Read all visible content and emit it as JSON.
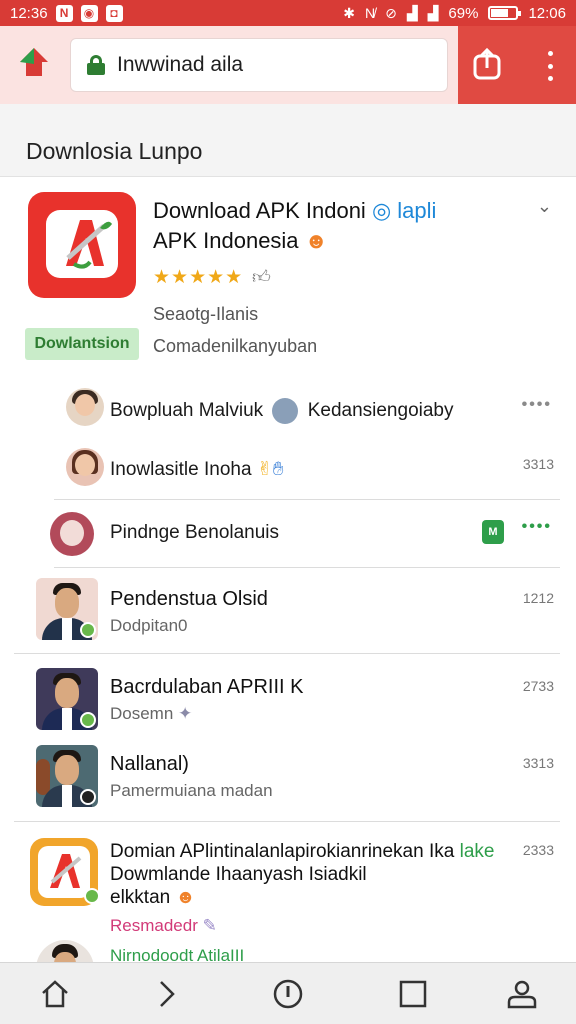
{
  "status_bar": {
    "time_left": "12:36 ",
    "time_right": "12:06",
    "battery": "69%",
    "battery_level": 0.69
  },
  "toolbar": {
    "url": "Inwwinad aila"
  },
  "page": {
    "title": "Downlosia Lunpo"
  },
  "app": {
    "title_line1": "Download APK Indoni",
    "title_blue": "lapli",
    "title_line2": "APK Indonesia",
    "rating": 5,
    "meta": "Seaotg-Ilanis",
    "badge": "Dowlantsion",
    "subtitle": "Comadenilkanyuban"
  },
  "threads": [
    {
      "text": "Bowpluah Malviuk",
      "text2": "Kedansiengoiaby",
      "end": "••••"
    },
    {
      "text": "Inowlasitle Inoha",
      "end": "3313"
    },
    {
      "text": "Pindnge Benolanuis",
      "chip": "M",
      "end": "••••"
    }
  ],
  "contacts": [
    {
      "name": "Pendenstua Olsid",
      "sub": "Dodpitan0",
      "time": "1212"
    },
    {
      "name": "Bacrdulaban APRIII K",
      "sub": "Dosemn",
      "time": "2733"
    },
    {
      "name": "Nallanal)",
      "sub": "Pamermuiana madan",
      "time": "3313"
    }
  ],
  "feature": {
    "line1": "Domian APlintinalanlapirokianrinekan Ika",
    "line1_green": "lake",
    "line2": "Dowmlande Ihaanyash",
    "line2_suffix": "Isiadkil",
    "line3": "elkktan",
    "tag_pink": "Resmadedr",
    "tag_green": "Nirnodoodt AtilaIII",
    "time": "2333"
  },
  "nav": [
    "home-icon",
    "forward-icon",
    "info-icon",
    "tabs-icon",
    "account-icon"
  ],
  "colors": {
    "accent": "#d83b36",
    "green": "#2e9e4a",
    "blue": "#1e88d8"
  }
}
